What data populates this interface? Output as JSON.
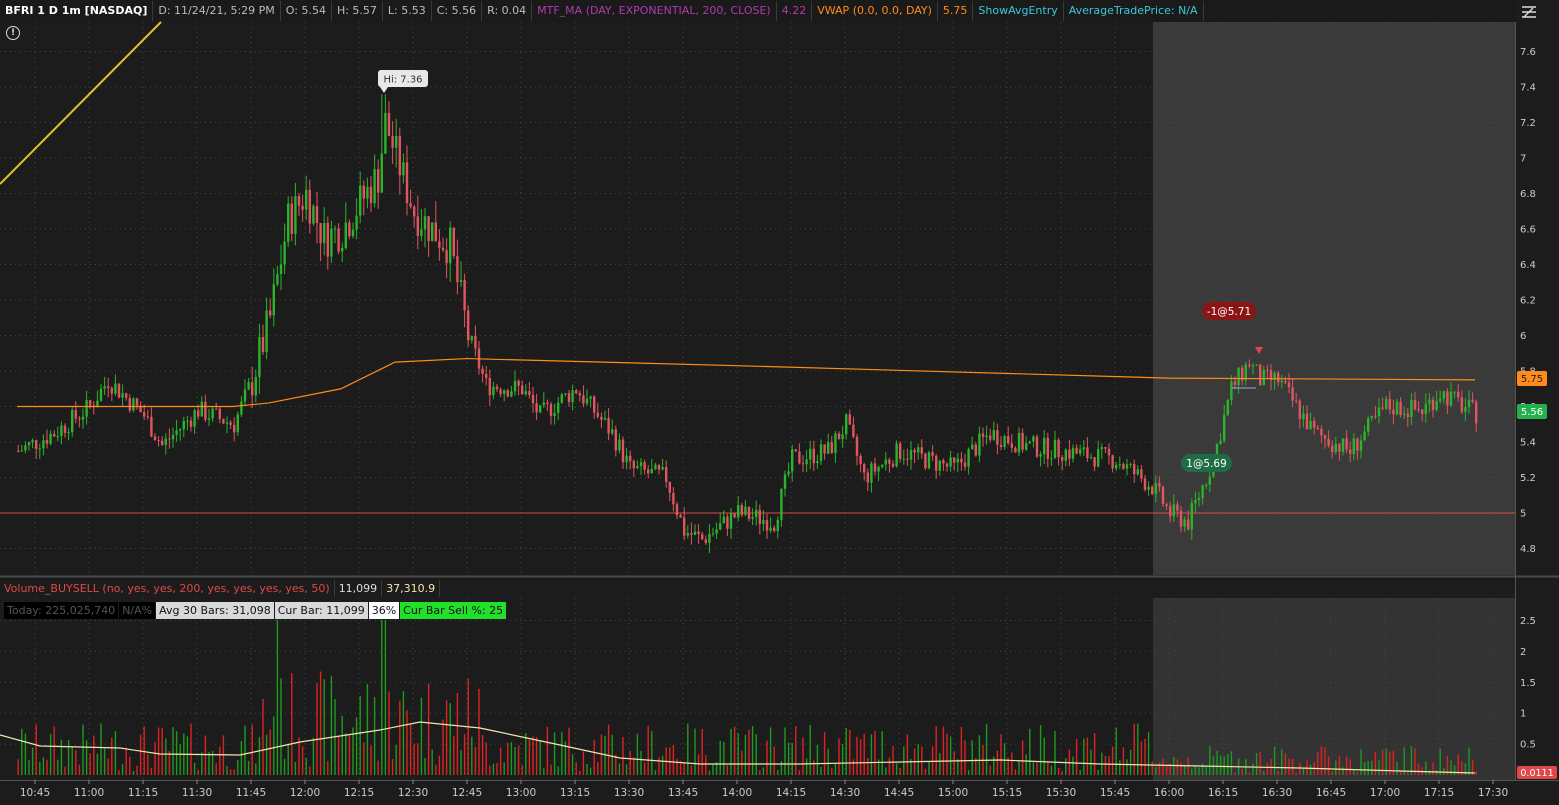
{
  "header": {
    "symbol": "BFRI 1 D 1m [NASDAQ]",
    "date": "D: 11/24/21, 5:29 PM",
    "open": "O: 5.54",
    "high": "H: 5.57",
    "low": "L: 5.53",
    "close": "C: 5.56",
    "range": "R: 0.04",
    "mtf_label": "MTF_MA (DAY, EXPONENTIAL, 200, CLOSE)",
    "mtf_value": "4.22",
    "vwap_label": "VWAP (0.0, 0.0, DAY)",
    "vwap_value": "5.75",
    "show_avg": "ShowAvgEntry",
    "avg_trade": "AverageTradePrice: N/A"
  },
  "colors": {
    "up": "#2bb32b",
    "down": "#e0555f",
    "ma": "#ff8c1a",
    "yellow_line": "#e6c228",
    "support_line": "#e04848",
    "afterhours_bg": "#3a3a3a",
    "bg": "#1c1c1c"
  },
  "price_axis": {
    "ticks": [
      "7.6",
      "7.4",
      "7.2",
      "7",
      "6.8",
      "6.6",
      "6.4",
      "6.2",
      "6",
      "5.8",
      "5.6",
      "5.4",
      "5.2",
      "5",
      "4.8"
    ],
    "vwap_badge": "5.75",
    "last_badge": "5.56"
  },
  "annotations": {
    "high_label": "Hi: 7.36",
    "sell_order": "-1@5.71",
    "buy_order": "1@5.69"
  },
  "volume": {
    "label": "Volume_BUYSELL (no, yes, yes, 200, yes, yes, yes, yes, 50)",
    "value1": "11,099",
    "value2": "37,310.9",
    "today": "Today: 225,025,740",
    "na": "N/A%",
    "avg30": "Avg 30 Bars: 31,098",
    "cur_bar": "Cur Bar: 11,099",
    "pct": "36%",
    "sell_pct": "Cur Bar Sell %: 25",
    "axis_ticks": [
      "2.5",
      "2",
      "1.5",
      "1",
      "0.5"
    ],
    "last_badge": "0.0111"
  },
  "time_axis": [
    "10:45",
    "11:00",
    "11:15",
    "11:30",
    "11:45",
    "12:00",
    "12:15",
    "12:30",
    "12:45",
    "13:00",
    "13:15",
    "13:30",
    "13:45",
    "14:00",
    "14:15",
    "14:30",
    "14:45",
    "15:00",
    "15:15",
    "15:30",
    "15:45",
    "16:00",
    "16:15",
    "16:30",
    "16:45",
    "17:00",
    "17:15",
    "17:30"
  ],
  "chart_data": {
    "type": "candlestick",
    "y_range": [
      4.7,
      7.7
    ],
    "key_points": [
      {
        "t": "10:40",
        "p": 5.35
      },
      {
        "t": "10:50",
        "p": 5.45
      },
      {
        "t": "11:00",
        "p": 5.6
      },
      {
        "t": "11:05",
        "p": 5.75
      },
      {
        "t": "11:15",
        "p": 5.55
      },
      {
        "t": "11:20",
        "p": 5.38
      },
      {
        "t": "11:30",
        "p": 5.58
      },
      {
        "t": "11:40",
        "p": 5.5
      },
      {
        "t": "11:45",
        "p": 5.75
      },
      {
        "t": "11:50",
        "p": 6.1
      },
      {
        "t": "11:55",
        "p": 6.65
      },
      {
        "t": "12:00",
        "p": 6.8
      },
      {
        "t": "12:05",
        "p": 6.55
      },
      {
        "t": "12:10",
        "p": 6.6
      },
      {
        "t": "12:20",
        "p": 6.9
      },
      {
        "t": "12:22",
        "p": 7.2
      },
      {
        "t": "12:30",
        "p": 6.7
      },
      {
        "t": "12:40",
        "p": 6.5
      },
      {
        "t": "12:45",
        "p": 6.0
      },
      {
        "t": "12:50",
        "p": 5.72
      },
      {
        "t": "13:00",
        "p": 5.7
      },
      {
        "t": "13:05",
        "p": 5.55
      },
      {
        "t": "13:15",
        "p": 5.7
      },
      {
        "t": "13:25",
        "p": 5.45
      },
      {
        "t": "13:30",
        "p": 5.25
      },
      {
        "t": "13:40",
        "p": 5.2
      },
      {
        "t": "13:45",
        "p": 4.9
      },
      {
        "t": "13:50",
        "p": 4.85
      },
      {
        "t": "14:00",
        "p": 5.0
      },
      {
        "t": "14:10",
        "p": 4.95
      },
      {
        "t": "14:15",
        "p": 5.3
      },
      {
        "t": "14:25",
        "p": 5.35
      },
      {
        "t": "14:30",
        "p": 5.5
      },
      {
        "t": "14:35",
        "p": 5.2
      },
      {
        "t": "14:45",
        "p": 5.35
      },
      {
        "t": "15:00",
        "p": 5.25
      },
      {
        "t": "15:10",
        "p": 5.45
      },
      {
        "t": "15:20",
        "p": 5.38
      },
      {
        "t": "15:30",
        "p": 5.35
      },
      {
        "t": "15:45",
        "p": 5.3
      },
      {
        "t": "15:55",
        "p": 5.15
      },
      {
        "t": "16:00",
        "p": 5.0
      },
      {
        "t": "16:05",
        "p": 4.95
      },
      {
        "t": "16:12",
        "p": 5.3
      },
      {
        "t": "16:17",
        "p": 5.7
      },
      {
        "t": "16:22",
        "p": 5.85
      },
      {
        "t": "16:25",
        "p": 5.75
      },
      {
        "t": "16:30",
        "p": 5.75
      },
      {
        "t": "16:40",
        "p": 5.45
      },
      {
        "t": "16:50",
        "p": 5.35
      },
      {
        "t": "17:00",
        "p": 5.6
      },
      {
        "t": "17:10",
        "p": 5.58
      },
      {
        "t": "17:15",
        "p": 5.68
      },
      {
        "t": "17:25",
        "p": 5.56
      }
    ],
    "vwap_points": [
      {
        "t": "10:40",
        "p": 5.6
      },
      {
        "t": "11:40",
        "p": 5.6
      },
      {
        "t": "11:50",
        "p": 5.62
      },
      {
        "t": "12:10",
        "p": 5.7
      },
      {
        "t": "12:25",
        "p": 5.85
      },
      {
        "t": "12:45",
        "p": 5.87
      },
      {
        "t": "14:00",
        "p": 5.83
      },
      {
        "t": "16:00",
        "p": 5.76
      },
      {
        "t": "17:25",
        "p": 5.75
      }
    ],
    "support_level": 5.0,
    "high": 7.36
  }
}
